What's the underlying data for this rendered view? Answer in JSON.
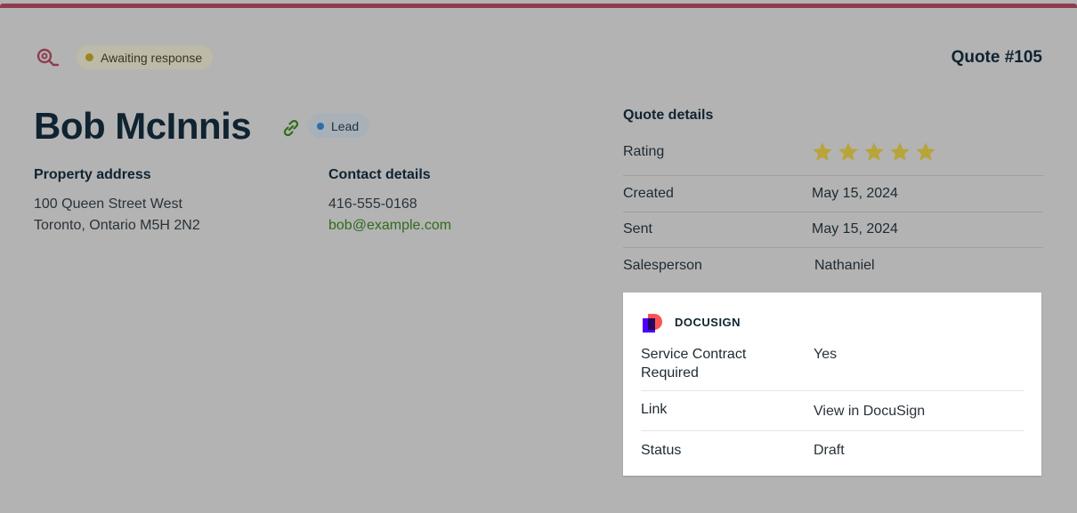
{
  "header": {
    "status_label": "Awaiting response",
    "quote_number": "Quote #105"
  },
  "client": {
    "name": "Bob McInnis",
    "tag": "Lead"
  },
  "property": {
    "title": "Property address",
    "line1": "100 Queen Street West",
    "line2": "Toronto, Ontario M5H 2N2"
  },
  "contact": {
    "title": "Contact details",
    "phone": "416-555-0168",
    "email": "bob@example.com"
  },
  "quote_details": {
    "title": "Quote details",
    "rating_label": "Rating",
    "rating_value": 5,
    "rating_max": 5,
    "created_label": "Created",
    "created_value": "May 15, 2024",
    "sent_label": "Sent",
    "sent_value": "May 15, 2024",
    "salesperson_label": "Salesperson",
    "salesperson_value": "Nathaniel"
  },
  "docusign": {
    "title": "DOCUSIGN",
    "service_contract_label": "Service Contract Required",
    "service_contract_value": "Yes",
    "link_label": "Link",
    "link_value": "View in DocuSign",
    "status_label": "Status",
    "status_value": "Draft"
  },
  "colors": {
    "accent": "#8e3d4f",
    "link_green": "#2f6b1a",
    "star": "#b8a43a",
    "awaiting_dot": "#9a8620",
    "lead_dot": "#2d6fa8"
  },
  "icons": {
    "quote": "quote-icon",
    "link": "link-icon",
    "star": "star-icon",
    "docusign": "docusign-logo-icon"
  }
}
